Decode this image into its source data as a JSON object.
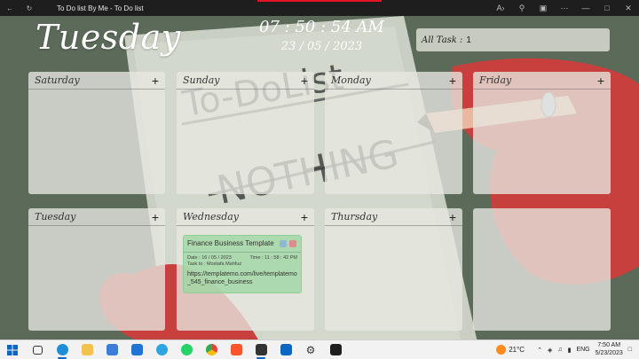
{
  "window": {
    "title": "To Do list By Me - To Do list",
    "back_icon": "back-arrow-icon",
    "refresh_icon": "refresh-icon",
    "buttons": [
      "read-aloud-icon",
      "zoom-icon",
      "screenshot-icon",
      "more-icon",
      "minimize-icon",
      "maximize-icon",
      "close-icon"
    ]
  },
  "header": {
    "day": "Tuesday",
    "time": "07 : 50 : 54 AM",
    "date": "23 / 05 / 2023",
    "all_task_label": "All Task :",
    "all_task_count": "1"
  },
  "days": [
    {
      "name": "Saturday",
      "add": "+"
    },
    {
      "name": "Sunday",
      "add": "+"
    },
    {
      "name": "Monday",
      "add": "+"
    },
    {
      "name": "Friday",
      "add": "+"
    },
    {
      "name": "Tuesday",
      "add": "+"
    },
    {
      "name": "Wednesday",
      "add": "+"
    },
    {
      "name": "Thursday",
      "add": "+"
    }
  ],
  "task": {
    "title": "Finance Business Template",
    "date": "Date : 16 / 05 / 2023",
    "time": "Time : 11 : 58 : 42 PM",
    "assignee": "Task to : Mostafa Mahfuz",
    "description": "https://templatemo.com/live/templatemo_545_finance_business"
  },
  "background_text": {
    "line1": "To-DoList",
    "line2": "NOTHING"
  },
  "taskbar": {
    "weather": "21°C",
    "language": "ENG",
    "time": "7:50 AM",
    "date": "5/23/2023",
    "apps": [
      "windows-start-icon",
      "task-view-icon",
      "edge-icon",
      "file-explorer-icon",
      "store-icon",
      "mail-icon",
      "telegram-icon",
      "whatsapp-icon",
      "chrome-icon",
      "brave-icon",
      "todo-app-icon",
      "linkedin-icon",
      "settings-icon",
      "terminal-icon"
    ]
  },
  "colors": {
    "card_bg": "#e8e8e2",
    "task_bg": "#9cd6a0",
    "title_bar": "#1e1e1e",
    "red_hand": "#d9413f"
  }
}
